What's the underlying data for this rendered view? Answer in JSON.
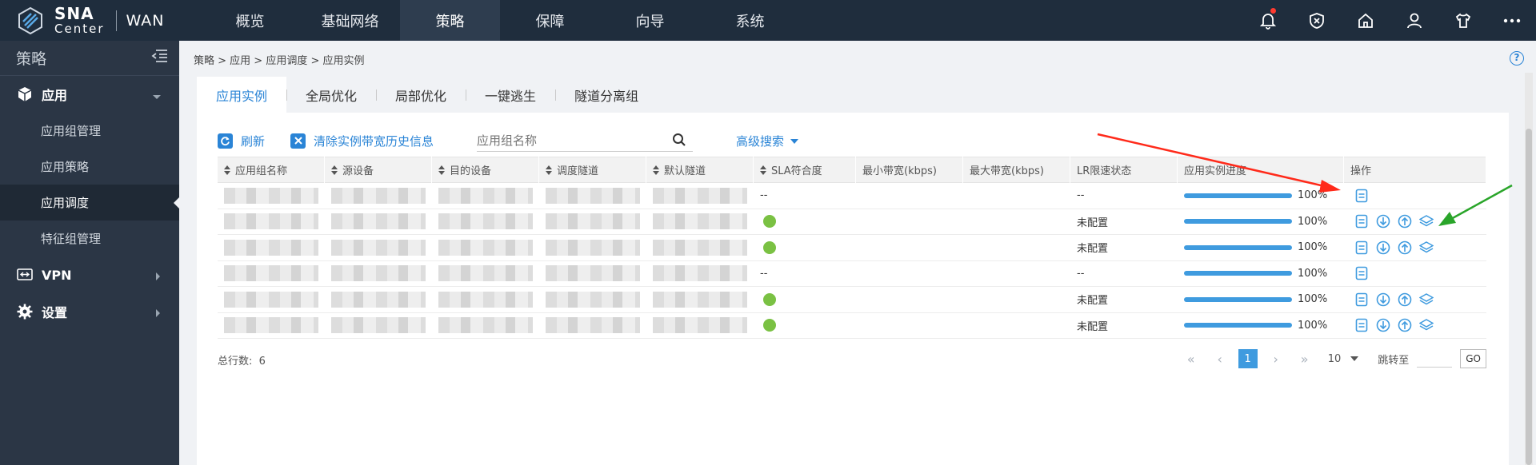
{
  "brand": {
    "name_line1": "SNA",
    "name_line2": "Center",
    "product": "WAN"
  },
  "nav": {
    "items": [
      "概览",
      "基础网络",
      "策略",
      "保障",
      "向导",
      "系统"
    ],
    "active_index": 2
  },
  "top_icons": [
    "bell-icon",
    "shield-icon",
    "home-icon",
    "user-icon",
    "shirt-icon",
    "more-icon"
  ],
  "sidebar": {
    "title": "策略",
    "groups": [
      {
        "label": "应用",
        "icon": "cube-icon",
        "expanded": true,
        "items": [
          "应用组管理",
          "应用策略",
          "应用调度",
          "特征组管理"
        ],
        "active_item": "应用调度"
      },
      {
        "label": "VPN",
        "icon": "vpn-icon",
        "expanded": false
      },
      {
        "label": "设置",
        "icon": "gear-icon",
        "expanded": false
      }
    ]
  },
  "breadcrumb": "策略 > 应用 > 应用调度 > 应用实例",
  "tabs": [
    "应用实例",
    "全局优化",
    "局部优化",
    "一键逃生",
    "隧道分离组"
  ],
  "toolbar": {
    "refresh": "刷新",
    "clear": "清除实例带宽历史信息",
    "search_placeholder": "应用组名称",
    "advanced": "高级搜索"
  },
  "table": {
    "columns": [
      "应用组名称",
      "源设备",
      "目的设备",
      "调度隧道",
      "默认隧道",
      "SLA符合度",
      "最小带宽(kbps)",
      "最大带宽(kbps)",
      "LR限速状态",
      "应用实例进度",
      "操作"
    ],
    "rows": [
      {
        "sla": "--",
        "lr": "--",
        "progress": 100,
        "progress_text": "100%",
        "ops": [
          "detail"
        ]
      },
      {
        "sla": "green",
        "lr": "未配置",
        "progress": 100,
        "progress_text": "100%",
        "ops": [
          "detail",
          "download",
          "upload",
          "layers"
        ]
      },
      {
        "sla": "green",
        "lr": "未配置",
        "progress": 100,
        "progress_text": "100%",
        "ops": [
          "detail",
          "download",
          "upload",
          "layers"
        ]
      },
      {
        "sla": "--",
        "lr": "--",
        "progress": 100,
        "progress_text": "100%",
        "ops": [
          "detail"
        ]
      },
      {
        "sla": "green",
        "lr": "未配置",
        "progress": 100,
        "progress_text": "100%",
        "ops": [
          "detail",
          "download",
          "upload",
          "layers"
        ]
      },
      {
        "sla": "green",
        "lr": "未配置",
        "progress": 100,
        "progress_text": "100%",
        "ops": [
          "detail",
          "download",
          "upload",
          "layers"
        ]
      }
    ]
  },
  "footer": {
    "total_label": "总行数:",
    "total_value": "6",
    "current_page": "1",
    "page_size": "10",
    "jump_label": "跳转至",
    "go": "GO"
  },
  "colors": {
    "accent": "#2a84d6",
    "sla_ok": "#7ac143",
    "annotation_red": "#ff2a1a",
    "annotation_green": "#2aa52a"
  }
}
